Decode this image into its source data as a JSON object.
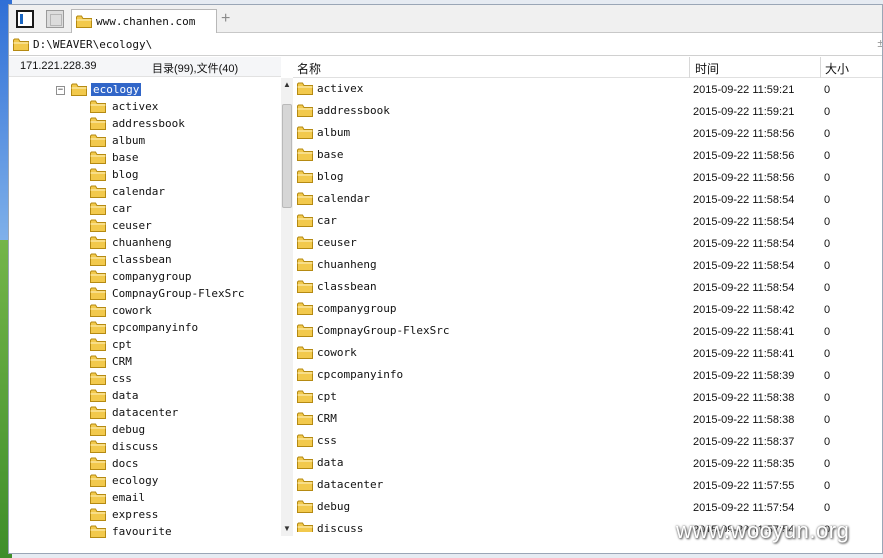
{
  "tab": {
    "title": "www.chanhen.com",
    "add": "+"
  },
  "address": {
    "path": "D:\\WEAVER\\ecology\\",
    "right_glyph": "±"
  },
  "info": {
    "ip": "171.221.228.39",
    "counts": "目录(99),文件(40)"
  },
  "columns": {
    "name": "名称",
    "time": "时间",
    "size": "大小"
  },
  "tree": {
    "root": {
      "label": "ecology",
      "expander": "−"
    },
    "items": [
      "activex",
      "addressbook",
      "album",
      "base",
      "blog",
      "calendar",
      "car",
      "ceuser",
      "chuanheng",
      "classbean",
      "companygroup",
      "CompnayGroup-FlexSrc",
      "cowork",
      "cpcompanyinfo",
      "cpt",
      "CRM",
      "css",
      "data",
      "datacenter",
      "debug",
      "discuss",
      "docs",
      "ecology",
      "email",
      "express",
      "favourite"
    ]
  },
  "files": [
    {
      "name": "activex",
      "time": "2015-09-22 11:59:21",
      "size": "0"
    },
    {
      "name": "addressbook",
      "time": "2015-09-22 11:59:21",
      "size": "0"
    },
    {
      "name": "album",
      "time": "2015-09-22 11:58:56",
      "size": "0"
    },
    {
      "name": "base",
      "time": "2015-09-22 11:58:56",
      "size": "0"
    },
    {
      "name": "blog",
      "time": "2015-09-22 11:58:56",
      "size": "0"
    },
    {
      "name": "calendar",
      "time": "2015-09-22 11:58:54",
      "size": "0"
    },
    {
      "name": "car",
      "time": "2015-09-22 11:58:54",
      "size": "0"
    },
    {
      "name": "ceuser",
      "time": "2015-09-22 11:58:54",
      "size": "0"
    },
    {
      "name": "chuanheng",
      "time": "2015-09-22 11:58:54",
      "size": "0"
    },
    {
      "name": "classbean",
      "time": "2015-09-22 11:58:54",
      "size": "0"
    },
    {
      "name": "companygroup",
      "time": "2015-09-22 11:58:42",
      "size": "0"
    },
    {
      "name": "CompnayGroup-FlexSrc",
      "time": "2015-09-22 11:58:41",
      "size": "0"
    },
    {
      "name": "cowork",
      "time": "2015-09-22 11:58:41",
      "size": "0"
    },
    {
      "name": "cpcompanyinfo",
      "time": "2015-09-22 11:58:39",
      "size": "0"
    },
    {
      "name": "cpt",
      "time": "2015-09-22 11:58:38",
      "size": "0"
    },
    {
      "name": "CRM",
      "time": "2015-09-22 11:58:38",
      "size": "0"
    },
    {
      "name": "css",
      "time": "2015-09-22 11:58:37",
      "size": "0"
    },
    {
      "name": "data",
      "time": "2015-09-22 11:58:35",
      "size": "0"
    },
    {
      "name": "datacenter",
      "time": "2015-09-22 11:57:55",
      "size": "0"
    },
    {
      "name": "debug",
      "time": "2015-09-22 11:57:54",
      "size": "0"
    },
    {
      "name": "discuss",
      "time": "2015-09-22 11:57:54",
      "size": "0"
    }
  ],
  "scrollbar": {
    "up": "▲",
    "down": "▼"
  },
  "watermark": "www.wooyun.org",
  "colors": {
    "selection": "#3166c8",
    "folder": "#f2c94c",
    "folder_edge": "#b58a12"
  },
  "icons": {
    "folder": "folder-icon"
  }
}
